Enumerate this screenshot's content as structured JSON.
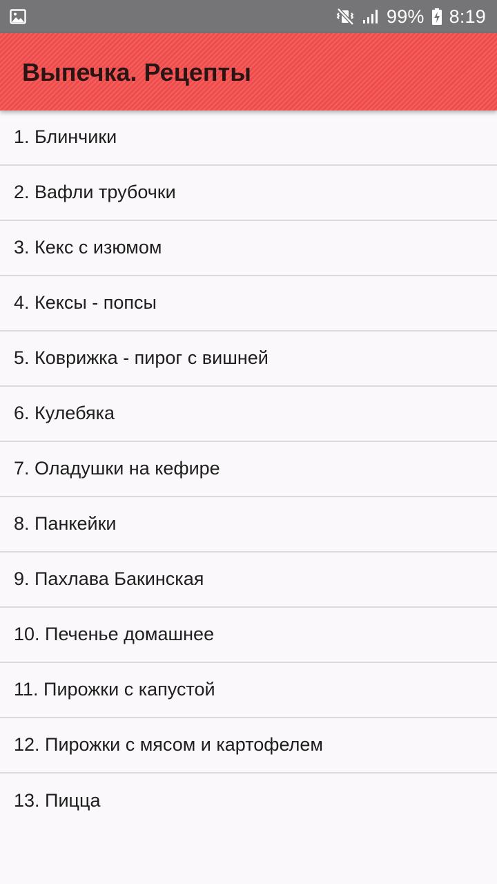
{
  "status_bar": {
    "battery": "99%",
    "time": "8:19",
    "icons": [
      "gallery-notification-icon",
      "mute-vibrate-icon",
      "signal-icon",
      "battery-charging-icon"
    ]
  },
  "app_bar": {
    "title": "Выпечка. Рецепты",
    "color": "#f44e4d"
  },
  "recipes": [
    {
      "label": "1. Блинчики"
    },
    {
      "label": "2. Вафли трубочки"
    },
    {
      "label": "3. Кекс с изюмом"
    },
    {
      "label": "4. Кексы - попсы"
    },
    {
      "label": "5. Коврижка - пирог с вишней"
    },
    {
      "label": "6. Кулебяка"
    },
    {
      "label": "7. Оладушки на кефире"
    },
    {
      "label": "8. Панкейки"
    },
    {
      "label": "9. Пахлава Бакинская"
    },
    {
      "label": "10. Печенье домашнее"
    },
    {
      "label": "11. Пирожки с капустой"
    },
    {
      "label": "12. Пирожки с мясом и картофелем"
    },
    {
      "label": "13. Пицца"
    }
  ]
}
